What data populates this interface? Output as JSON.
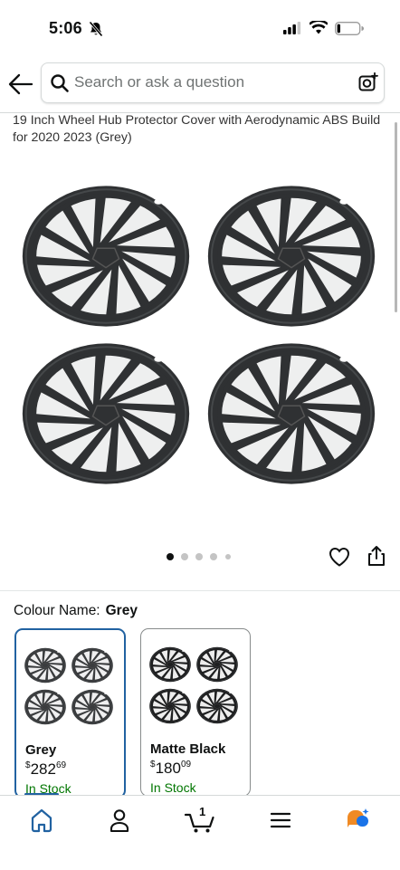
{
  "status_bar": {
    "time": "5:06",
    "icons": [
      "bell-slash-icon",
      "cellular-signal-icon",
      "wifi-icon",
      "battery-icon"
    ]
  },
  "header": {
    "back_icon": "arrow-left-icon",
    "search": {
      "placeholder": "Search or ask a question",
      "value": "",
      "icon": "search-icon",
      "camera_icon": "camera-lens-icon"
    }
  },
  "product": {
    "title": "19 Inch Wheel Hub Protector Cover with Aerodynamic ABS Build for 2020 2023 (Grey)",
    "image_count": 5,
    "active_image_index": 0,
    "actions": [
      "heart-icon",
      "share-icon"
    ]
  },
  "colour": {
    "label": "Colour Name:",
    "selected": "Grey",
    "options": [
      {
        "name": "Grey",
        "price_whole": "282",
        "price_fraction": "69",
        "currency": "$",
        "stock": "In Stock",
        "selected": true
      },
      {
        "name": "Matte Black",
        "price_whole": "180",
        "price_fraction": "09",
        "currency": "$",
        "stock": "In Stock",
        "selected": false
      }
    ]
  },
  "tabbar": {
    "items": [
      "home-icon",
      "account-icon",
      "cart-icon",
      "menu-icon",
      "assistant-icon"
    ],
    "cart_count": "1",
    "active": "home-icon"
  },
  "colors": {
    "accent": "#2162a1",
    "stock_green": "#007600",
    "wheel_dark": "#2f3133",
    "assistant_orange": "#f08a24",
    "assistant_blue": "#1a73e8"
  }
}
